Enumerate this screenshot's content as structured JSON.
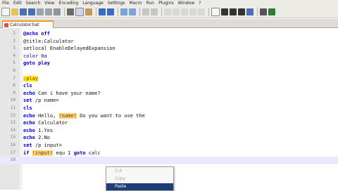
{
  "menu": [
    "File",
    "Edit",
    "Search",
    "View",
    "Encoding",
    "Language",
    "Settings",
    "Macro",
    "Run",
    "Plugins",
    "Window",
    "?"
  ],
  "tab": {
    "label": "Calculator.bat"
  },
  "lines": [
    {
      "n": "1",
      "parts": [
        {
          "t": "@echo off",
          "c": "kw"
        }
      ]
    },
    {
      "n": "2",
      "parts": [
        {
          "t": "@title:Calculator",
          "c": ""
        }
      ]
    },
    {
      "n": "3",
      "parts": [
        {
          "t": "setlocal EnableDelayedExpansion",
          "c": ""
        }
      ]
    },
    {
      "n": "4",
      "parts": [
        {
          "t": "color 0a",
          "c": "cmd"
        }
      ]
    },
    {
      "n": "5",
      "parts": [
        {
          "t": "goto play",
          "c": "kw"
        }
      ]
    },
    {
      "n": "6",
      "parts": []
    },
    {
      "n": "7",
      "parts": [
        {
          "t": ":play",
          "c": "lbl"
        }
      ]
    },
    {
      "n": "8",
      "parts": [
        {
          "t": "cls",
          "c": "kw"
        }
      ]
    },
    {
      "n": "9",
      "parts": [
        {
          "t": "echo",
          "c": "kw"
        },
        {
          "t": " Can i have your name?",
          "c": ""
        }
      ]
    },
    {
      "n": "10",
      "parts": [
        {
          "t": "set",
          "c": "kw"
        },
        {
          "t": " /p name=",
          "c": ""
        }
      ]
    },
    {
      "n": "11",
      "parts": [
        {
          "t": "cls",
          "c": "kw"
        }
      ]
    },
    {
      "n": "12",
      "parts": [
        {
          "t": "echo",
          "c": "kw"
        },
        {
          "t": " Hello, ",
          "c": ""
        },
        {
          "t": "!name!",
          "c": "var"
        },
        {
          "t": " Do you want to use the",
          "c": ""
        }
      ]
    },
    {
      "n": "13",
      "parts": [
        {
          "t": "echo",
          "c": "kw"
        },
        {
          "t": " Calculator",
          "c": ""
        }
      ]
    },
    {
      "n": "14",
      "parts": [
        {
          "t": "echo",
          "c": "kw"
        },
        {
          "t": " 1.Yes",
          "c": ""
        }
      ]
    },
    {
      "n": "15",
      "parts": [
        {
          "t": "echo",
          "c": "kw"
        },
        {
          "t": " 2.No",
          "c": ""
        }
      ]
    },
    {
      "n": "16",
      "parts": [
        {
          "t": "set",
          "c": "kw"
        },
        {
          "t": " /p input=",
          "c": ""
        }
      ]
    },
    {
      "n": "17",
      "parts": [
        {
          "t": "if",
          "c": "kw"
        },
        {
          "t": " ",
          "c": ""
        },
        {
          "t": "!input!",
          "c": "var"
        },
        {
          "t": " equ 1 ",
          "c": ""
        },
        {
          "t": "goto",
          "c": "kw"
        },
        {
          "t": " calc",
          "c": ""
        }
      ]
    },
    {
      "n": "18",
      "parts": []
    }
  ],
  "context_menu": {
    "cut": "Cut",
    "copy": "Copy",
    "paste": "Paste"
  }
}
